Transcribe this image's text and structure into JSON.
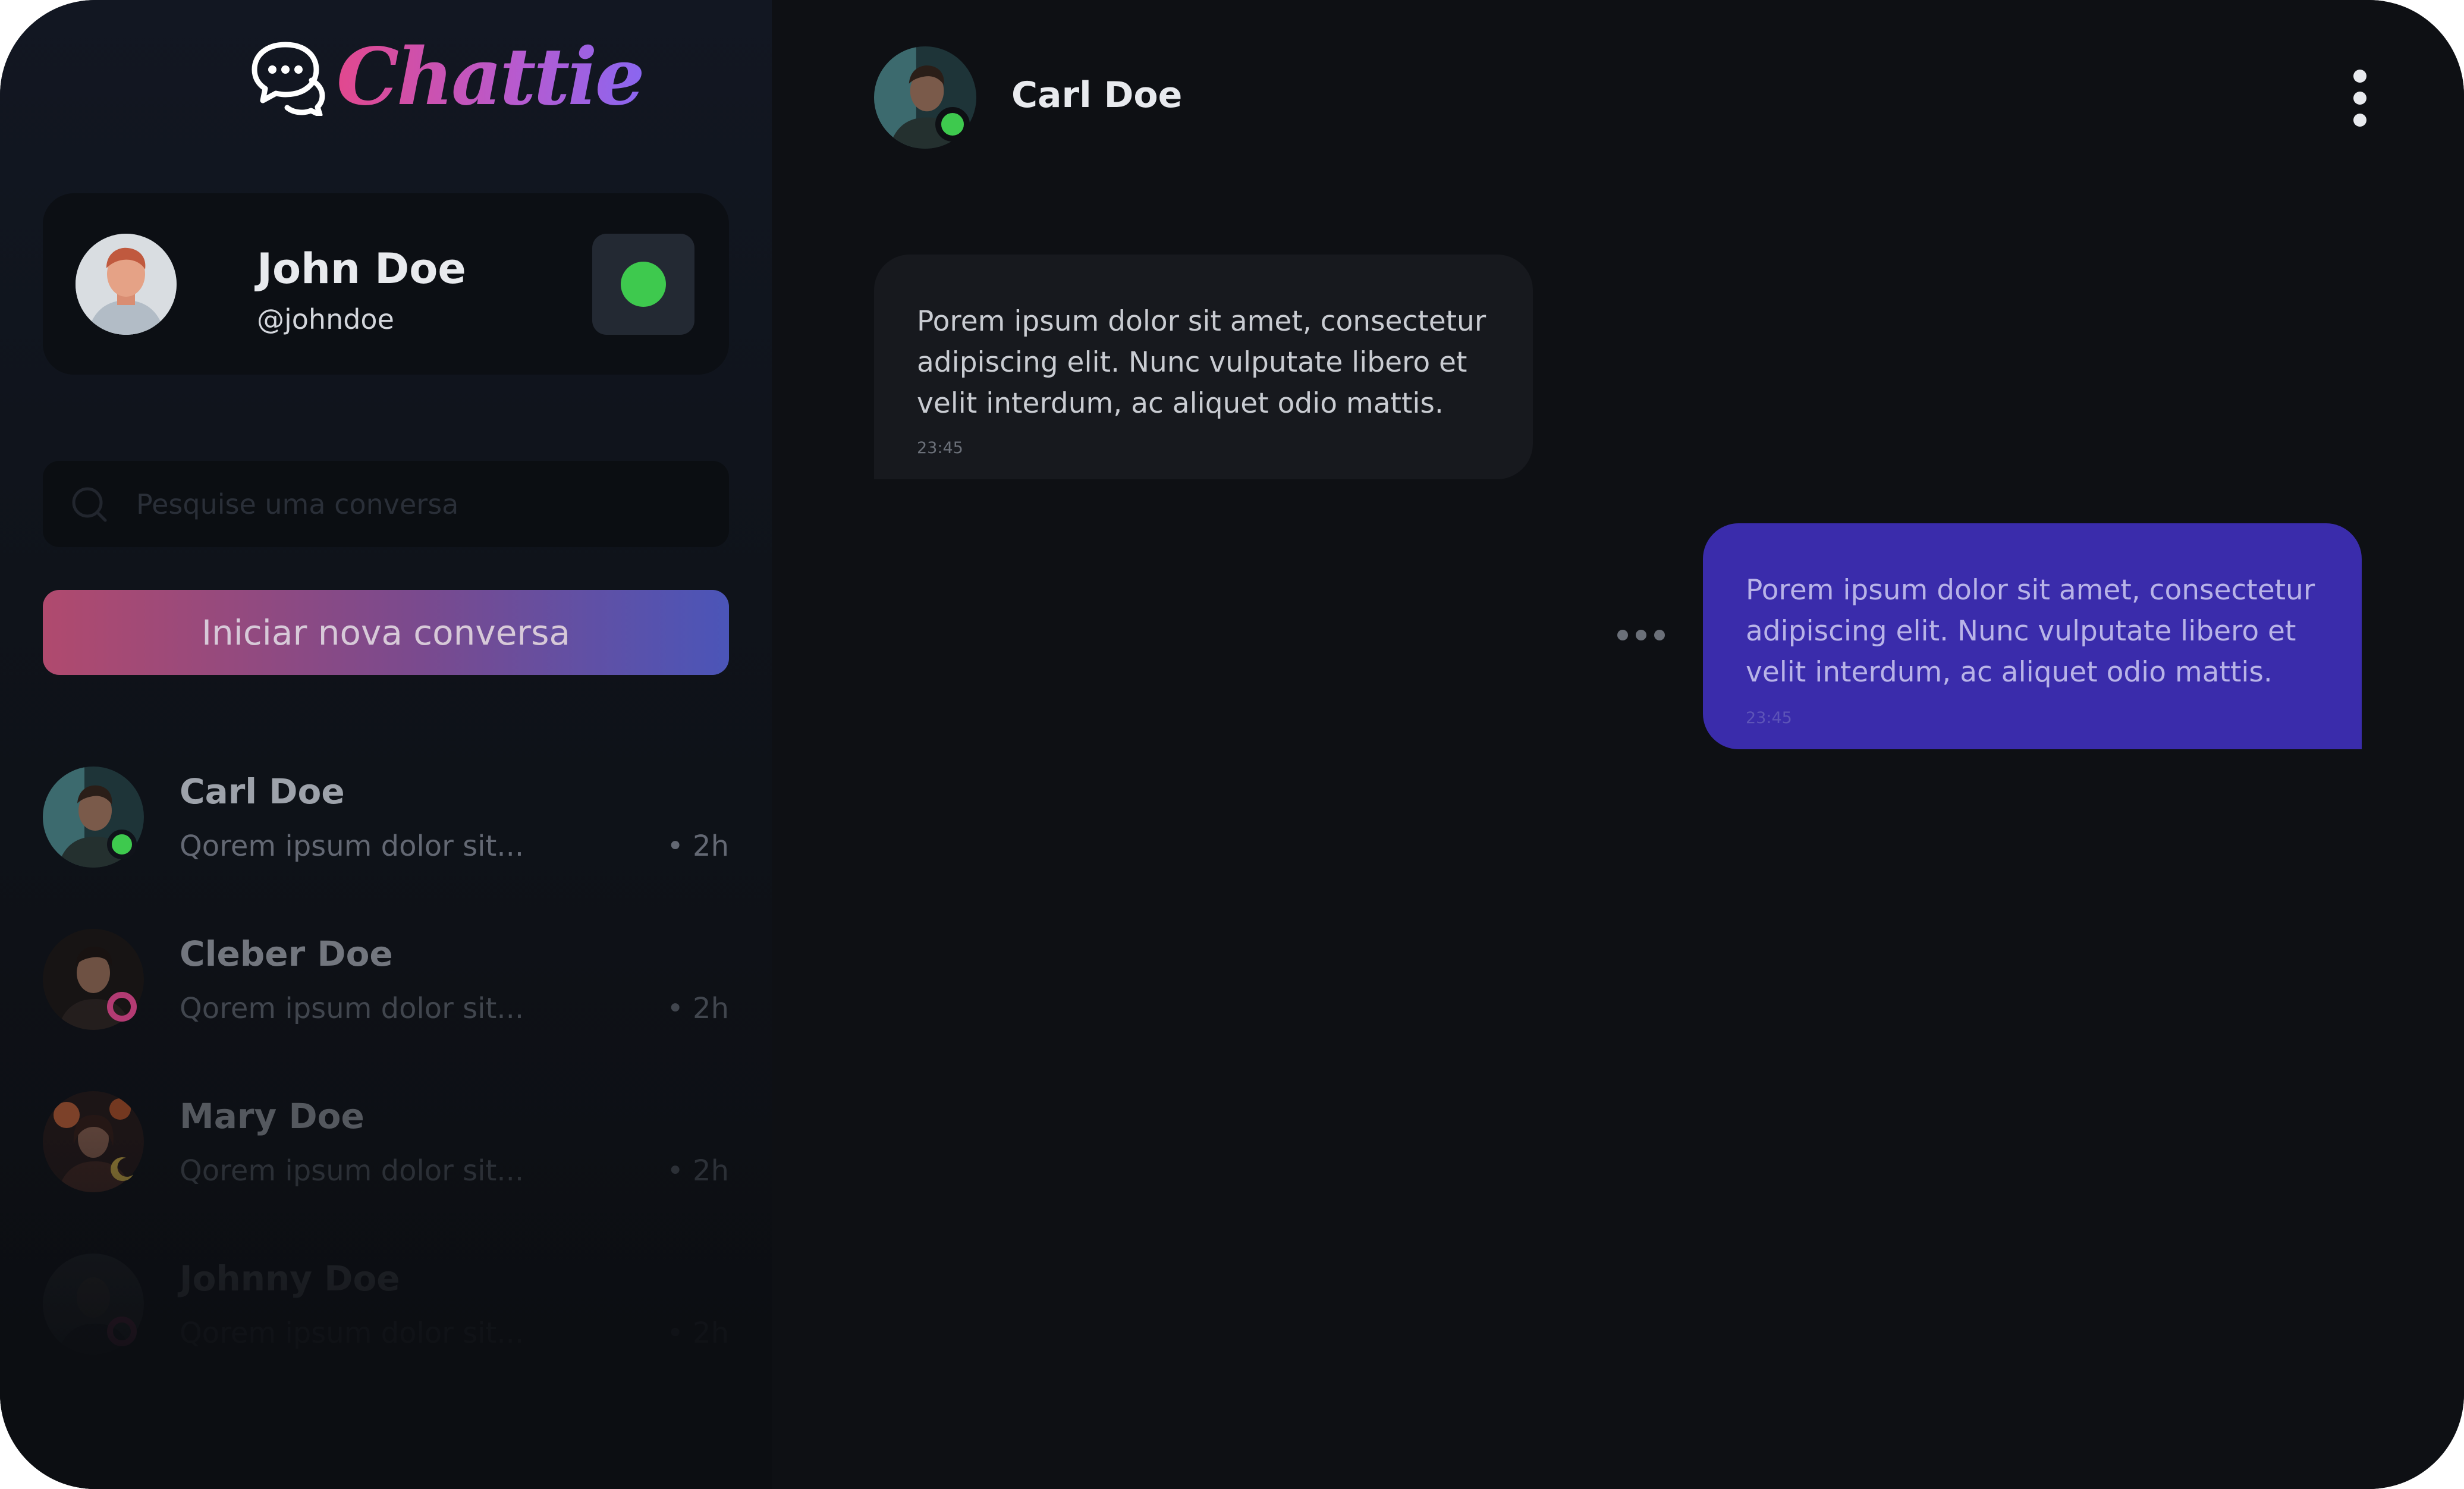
{
  "app": {
    "logo_text": "Chattie",
    "accent_gradient": [
      "#e2488e",
      "#8a66f0"
    ]
  },
  "profile": {
    "name": "John Doe",
    "handle": "@johndoe",
    "status": "online",
    "status_color": "#3ec94e",
    "avatar_icon": "user-avatar"
  },
  "search": {
    "placeholder": "Pesquise uma conversa",
    "icon": "search-icon"
  },
  "new_chat": {
    "label": "Iniciar nova conversa"
  },
  "conversations": [
    {
      "name": "Carl Doe",
      "preview": "Qorem ipsum dolor sit...",
      "time": "• 2h",
      "status": "online",
      "status_color": "#3ec94e"
    },
    {
      "name": "Cleber Doe",
      "preview": "Qorem ipsum dolor sit...",
      "time": "• 2h",
      "status": "busy",
      "status_color": "#e2488e"
    },
    {
      "name": "Mary Doe",
      "preview": "Qorem ipsum dolor sit...",
      "time": "• 2h",
      "status": "away",
      "status_color": "#e8c14a"
    },
    {
      "name": "Johnny Doe",
      "preview": "Qorem ipsum dolor sit...",
      "time": "• 2h",
      "status": "busy",
      "status_color": "#e2488e"
    }
  ],
  "chat": {
    "contact_name": "Carl Doe",
    "contact_status": "online",
    "menu_icon": "more-vertical-icon",
    "messages": [
      {
        "direction": "incoming",
        "text": "Porem ipsum dolor sit amet, consectetur\nadipiscing elit. Nunc vulputate libero et\nvelit interdum, ac aliquet odio mattis.",
        "time": "23:45",
        "bubble_color": "#17191e"
      },
      {
        "direction": "outgoing",
        "text": "Porem ipsum dolor sit amet, consectetur\nadipiscing elit. Nunc vulputate libero et\nvelit interdum, ac aliquet odio mattis.",
        "time": "23:45",
        "bubble_color": "#3a2cab"
      }
    ]
  }
}
